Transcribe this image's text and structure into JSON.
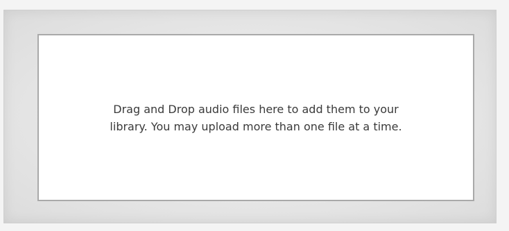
{
  "drop_zone": {
    "line1": "Drag and Drop audio files here to add them to your",
    "line2": "library. You may upload more than one file at a time."
  }
}
